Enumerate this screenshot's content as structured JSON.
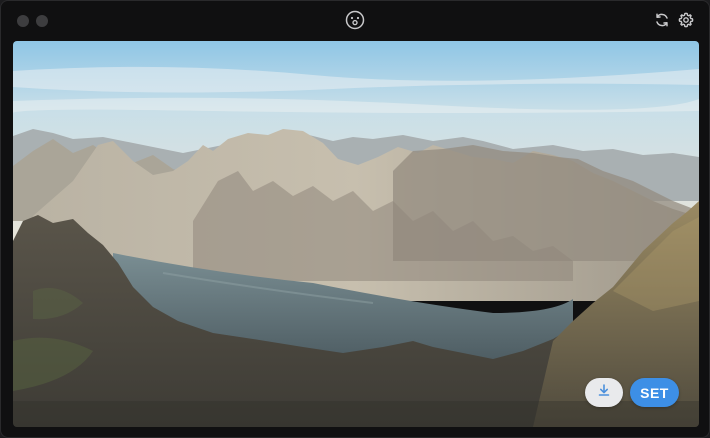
{
  "window": {
    "title": "",
    "traffic_lights": [
      "close",
      "minimize"
    ],
    "colors": {
      "background": "#101011",
      "traffic_light": "#3d3d3f",
      "accent": "#3d8fe6"
    }
  },
  "toolbar": {
    "center_icon": "face-logo-icon",
    "right_icons": [
      "refresh-icon",
      "gear-icon"
    ]
  },
  "wallpaper": {
    "description_icon": "mountain-fjord-photo"
  },
  "actions": {
    "download_icon": "download-icon",
    "set_label": "SET"
  }
}
